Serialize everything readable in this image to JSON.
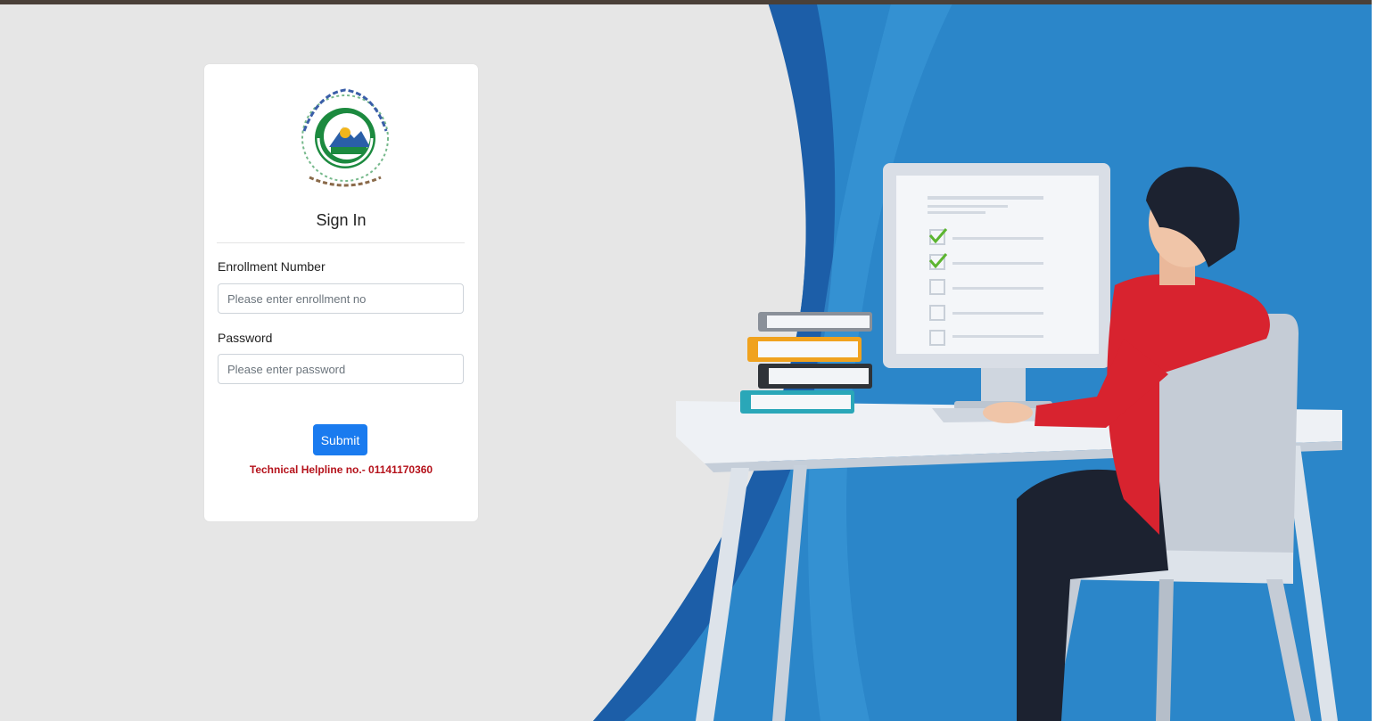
{
  "login": {
    "title": "Sign In",
    "enrollment_label": "Enrollment Number",
    "enrollment_placeholder": "Please enter enrollment no",
    "enrollment_value": "",
    "password_label": "Password",
    "password_placeholder": "Please enter password",
    "password_value": "",
    "submit_label": "Submit",
    "helpline": "Technical Helpline no.- 01141170360"
  },
  "logo": {
    "icon": "university-emblem-icon"
  },
  "illustration": {
    "icon": "person-at-computer-illustration"
  },
  "colors": {
    "page_background": "#e6e6e6",
    "accent_blue": "#1a7bef",
    "panel_blue": "#2b86c9",
    "helpline_red": "#b5121b",
    "emblem_green": "#1c8a3f"
  }
}
